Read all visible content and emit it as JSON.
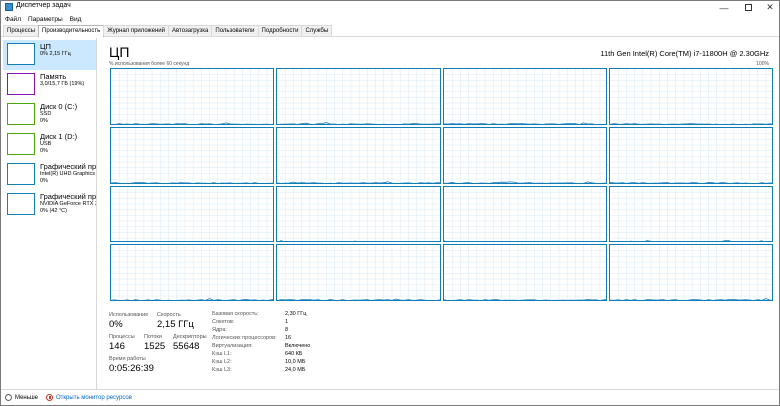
{
  "window": {
    "title": "Диспетчер задач"
  },
  "menu": [
    "Файл",
    "Параметры",
    "Вид"
  ],
  "tabs": [
    {
      "label": "Процессы",
      "active": false
    },
    {
      "label": "Производительность",
      "active": true
    },
    {
      "label": "Журнал приложений",
      "active": false
    },
    {
      "label": "Автозагрузка",
      "active": false
    },
    {
      "label": "Пользователи",
      "active": false
    },
    {
      "label": "Подробности",
      "active": false
    },
    {
      "label": "Службы",
      "active": false
    }
  ],
  "sidebar": {
    "items": [
      {
        "name": "ЦП",
        "line1": "0% 2,15 ГГц",
        "line2": "",
        "color": "#117dbb",
        "selected": true
      },
      {
        "name": "Память",
        "line1": "3,0/15,7 ГБ (19%)",
        "line2": "",
        "color": "#8b12ae",
        "selected": false
      },
      {
        "name": "Диск 0 (C:)",
        "line1": "SSD",
        "line2": "0%",
        "color": "#4da60c",
        "selected": false
      },
      {
        "name": "Диск 1 (D:)",
        "line1": "USB",
        "line2": "0%",
        "color": "#4da60c",
        "selected": false
      },
      {
        "name": "Графический про",
        "line1": "Intel(R) UHD Graphics",
        "line2": "0%",
        "color": "#117dbb",
        "selected": false
      },
      {
        "name": "Графический про",
        "line1": "NVIDIA GeForce RTX 307",
        "line2": "0% (42 °C)",
        "color": "#117dbb",
        "selected": false
      }
    ]
  },
  "main": {
    "title": "ЦП",
    "cpu_model": "11th Gen Intel(R) Core(TM) i7-11800H @ 2.30GHz",
    "usage_label": "% использования более 60 секунд",
    "usage_max": "100%",
    "graph_color": "#117dbb",
    "graph_grid_color": "#d9eaf7",
    "core_count": 16
  },
  "stats": {
    "usage": {
      "label": "Использование",
      "value": "0%"
    },
    "speed": {
      "label": "Скорость",
      "value": "2,15 ГГц"
    },
    "processes": {
      "label": "Процессы",
      "value": "146"
    },
    "threads": {
      "label": "Потоки",
      "value": "1525"
    },
    "handles": {
      "label": "Дескрипторы",
      "value": "55648"
    },
    "uptime": {
      "label": "Время работы",
      "value": "0:05:26:39"
    },
    "details": [
      {
        "key": "Базовая скорость:",
        "value": "2,30 ГГц"
      },
      {
        "key": "Сокетов:",
        "value": "1"
      },
      {
        "key": "Ядра:",
        "value": "8"
      },
      {
        "key": "Логических процессоров:",
        "value": "16"
      },
      {
        "key": "Виртуализация:",
        "value": "Включено"
      },
      {
        "key": "Кэш L1:",
        "value": "640 КБ"
      },
      {
        "key": "Кэш L2:",
        "value": "10,0 МБ"
      },
      {
        "key": "Кэш L3:",
        "value": "24,0 МБ"
      }
    ]
  },
  "footer": {
    "less_label": "Меньше",
    "monitor_link": "Открыть монитор ресурсов"
  }
}
